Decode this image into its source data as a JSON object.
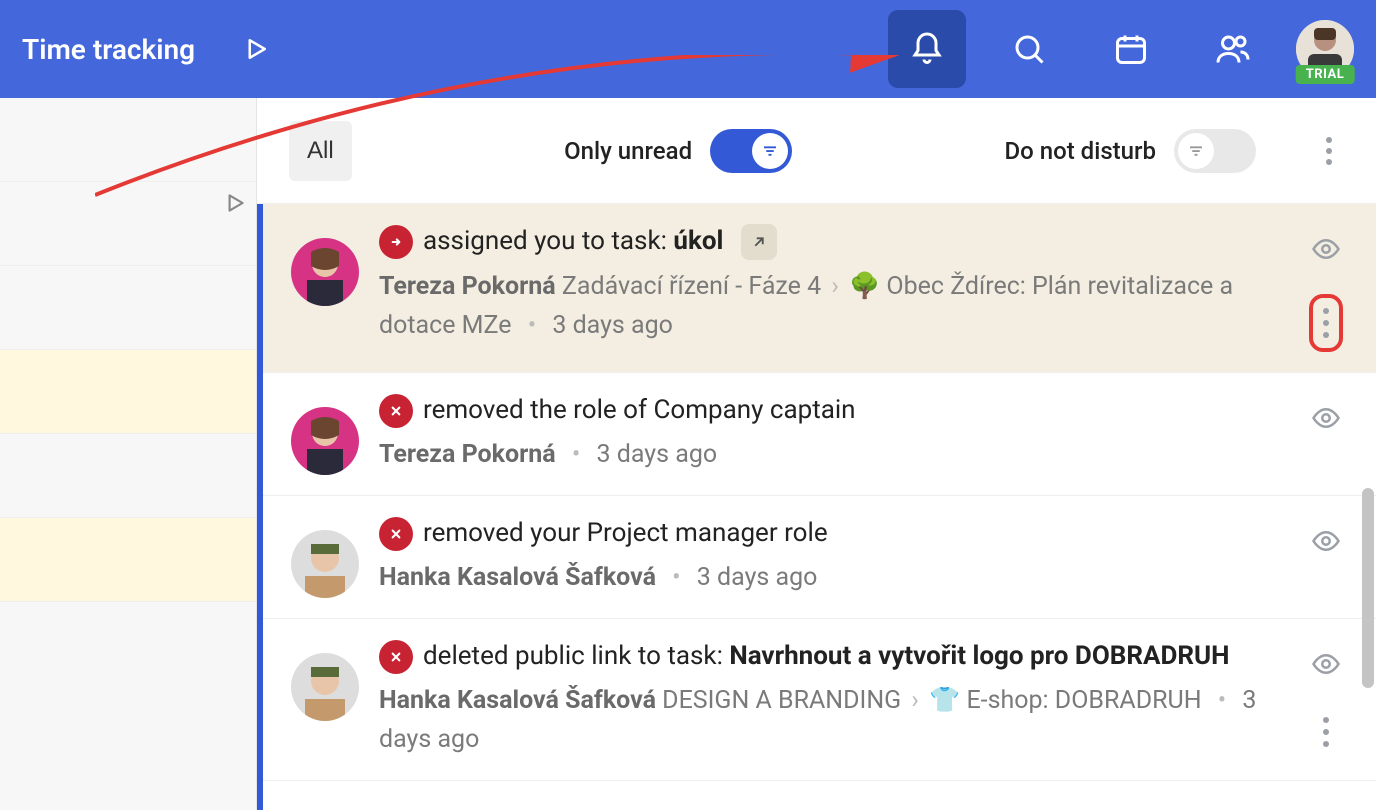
{
  "header": {
    "title": "Time tracking",
    "trial_badge": "TRIAL"
  },
  "filter": {
    "all": "All",
    "only_unread": "Only unread",
    "dnd": "Do not disturb"
  },
  "notifications": [
    {
      "icon": "arrow",
      "action_pre": "assigned you to task: ",
      "action_bold": "úkol",
      "author": "Tereza Pokorná",
      "crumb1": "Zadávací řízení - Fáze 4",
      "crumb2_emoji": "🌳",
      "crumb2": "Obec Ždírec: Plán revitalizace a dotace MZe",
      "time": "3 days ago",
      "highlight": true,
      "open_link": true,
      "dots_circled": true
    },
    {
      "icon": "x",
      "action_pre": "removed the role of Company captain",
      "action_bold": "",
      "author": "Tereza Pokorná",
      "time": "3 days ago"
    },
    {
      "icon": "x",
      "action_pre": "removed your Project manager role",
      "action_bold": "",
      "author": "Hanka Kasalová Šafková",
      "time": "3 days ago"
    },
    {
      "icon": "x",
      "action_pre": "deleted public link to task: ",
      "action_bold": "Navrhnout a vytvořit logo pro DOBRADRUH",
      "author": "Hanka Kasalová Šafková",
      "crumb1": "DESIGN A BRANDING",
      "crumb2_emoji": "👕",
      "crumb2": "E-shop: DOBRADRUH",
      "time": "3 days ago",
      "dots": true
    }
  ]
}
